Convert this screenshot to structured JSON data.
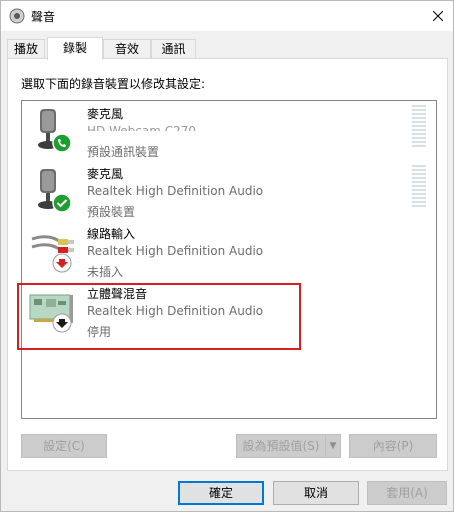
{
  "window": {
    "title": "聲音",
    "title_icon": "speaker-icon",
    "close_icon": "close-icon"
  },
  "tabs": [
    {
      "label": "播放",
      "active": false
    },
    {
      "label": "錄製",
      "active": true
    },
    {
      "label": "音效",
      "active": false
    },
    {
      "label": "通訊",
      "active": false
    }
  ],
  "instruction": "選取下面的錄音裝置以修改其設定:",
  "devices": [
    {
      "name": "麥克風",
      "description": "HD Webcam C270",
      "status": "預設通訊裝置",
      "icon": "microphone-icon",
      "badge": "phone-badge-icon",
      "badge_color": "#1e9e2f"
    },
    {
      "name": "麥克風",
      "description": "Realtek High Definition Audio",
      "status": "預設裝置",
      "icon": "microphone-icon",
      "badge": "check-badge-icon",
      "badge_color": "#1e9e2f"
    },
    {
      "name": "線路輸入",
      "description": "Realtek High Definition Audio",
      "status": "未插入",
      "icon": "line-in-cable-icon",
      "badge": "down-arrow-badge-icon",
      "badge_color": "#d42020"
    },
    {
      "name": "立體聲混音",
      "description": "Realtek High Definition Audio",
      "status": "停用",
      "icon": "sound-card-icon",
      "badge": "down-arrow-badge-icon",
      "badge_color": "#ffffff"
    }
  ],
  "buttons": {
    "configure": "設定(C)",
    "set_default": "設為預設值(S)",
    "properties": "內容(P)",
    "ok": "確定",
    "cancel": "取消",
    "apply": "套用(A)"
  },
  "colors": {
    "highlight_border": "#d42020",
    "accent": "#0078d7"
  }
}
